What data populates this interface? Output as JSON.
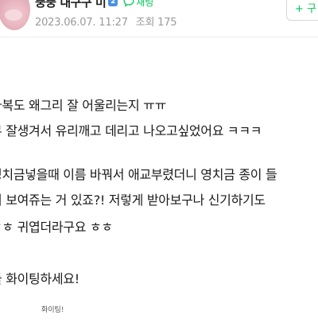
{
  "header": {
    "author_name": "뚱뚱 내구구 미",
    "level_badge": "2",
    "chat_label": "채팅",
    "date": "2023.06.07. 11:27",
    "views_label": "조회 175",
    "follow_label": "+ 구"
  },
  "content": {
    "lines": [
      "바복도 왜그리 잘 어울리는지 ㅠㅠ",
      "무 잘생겨서 유리깨고 데리고 나오고싶었어요 ㅋㅋㅋ",
      "영치금넣을때 이름 바꿔서 애교부렸더니 영치금 종이 들",
      "서 보여쥬는 거 있죠?! 저렇게 받아보구나 신기하기도",
      "ㅎㅎ 귀엽더라구요 ㅎㅎ",
      "들 화이팅하세요!"
    ],
    "sticker_text": "화이팅!"
  },
  "colors": {
    "accent_green": "#03c75a",
    "meta_gray": "#9a9a9a",
    "badge_blue": "#4a90e2"
  }
}
